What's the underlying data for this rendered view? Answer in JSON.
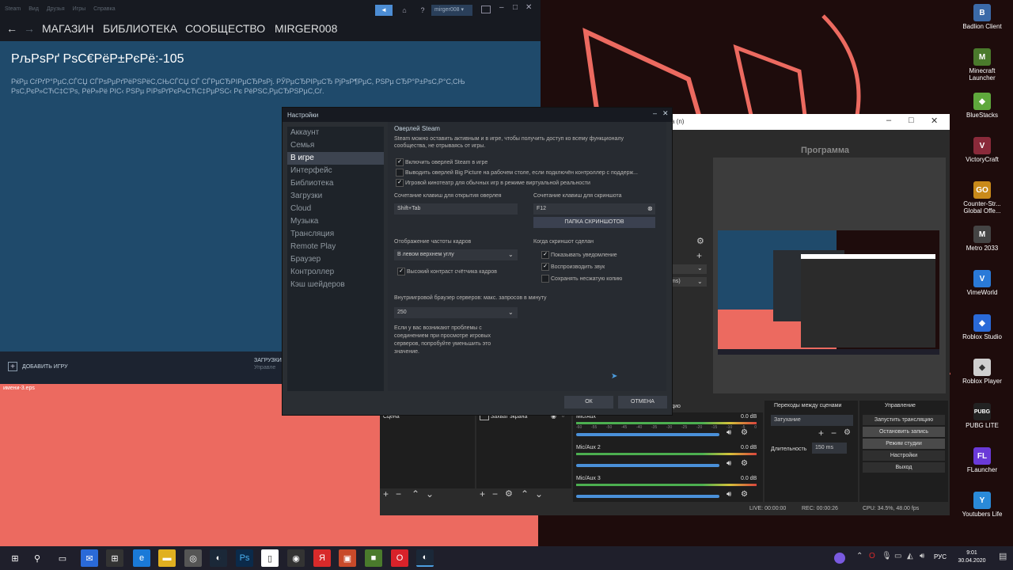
{
  "steam": {
    "titlebar_menu": [
      "Steam",
      "Вид",
      "Друзья",
      "Игры",
      "Справка"
    ],
    "username_pill": "mirger008",
    "help_label": "?",
    "nav": [
      "МАГАЗИН",
      "БИБЛИОТЕКА",
      "СООБЩЕСТВО",
      "MIRGER008"
    ],
    "page_title": "РљРѕРґ РѕС€РёР±РєРё:-105",
    "page_error_line1": "РќРµ СѓРґР°РµС‚СЃСЏ СЃРѕРµРґРёРЅРёС‚СЊСЃСЏ СЃ СЃРµСЂРІРµСЂРѕРј. РЎРµСЂРІРµСЂ РјРѕР¶РµС‚ РЅРµ СЂР°Р±РѕС‚Р°С‚СЊ",
    "page_error_line2": "РѕС‚РєР»СЋС‡С'Рѕ, РёР»Рё РІС‹ РЅРµ РїРѕРґРєР»СЋС‡РµРЅС‹ Рє РёРЅС‚РµСЂРЅРµС‚Сѓ.",
    "add_game": "ДОБАВИТЬ ИГРУ",
    "downloads": "ЗАГРУЗКИ",
    "downloads_sub": "Управле",
    "desktop_file": "имени-3.eps"
  },
  "settings": {
    "title": "Настройки",
    "sidebar": [
      "Аккаунт",
      "Семья",
      "В игре",
      "Интерфейс",
      "Библиотека",
      "Загрузки",
      "Cloud",
      "Музыка",
      "Трансляция",
      "Remote Play",
      "Браузер",
      "Контроллер",
      "Кэш шейдеров"
    ],
    "active_index": 2,
    "section_title": "Оверлей Steam",
    "section_desc_1": "Steam можно оставить активным и в игре, чтобы получить доступ ко всему функционалу",
    "section_desc_2": "сообщества, не отрываясь от игры.",
    "checkboxes": [
      {
        "label": "Включить оверлей Steam в игре",
        "checked": true
      },
      {
        "label": "Выводить оверлей Big Picture на рабочем столе, если подключён контроллер с поддерж...",
        "checked": false
      },
      {
        "label": "Игровой кинотеатр для обычных игр в режиме виртуальной реальности",
        "checked": true
      }
    ],
    "hotkey_overlay_label": "Сочетание клавиш для открытия оверлея",
    "hotkey_overlay_value": "Shift+Tab",
    "hotkey_screenshot_label": "Сочетание клавиш для скриншота",
    "hotkey_screenshot_value": "F12",
    "screenshot_folder_btn": "ПАПКА СКРИНШОТОВ",
    "fps_label": "Отображение частоты кадров",
    "fps_value": "В левом верхнем углу",
    "fps_contrast": {
      "label": "Высокий контраст счётчика кадров",
      "checked": true
    },
    "when_shot_label": "Когда скриншот сделан",
    "when_shot": [
      {
        "label": "Показывать уведомление",
        "checked": true
      },
      {
        "label": "Воспроизводить звук",
        "checked": true
      },
      {
        "label": "Сохранять несжатую копию",
        "checked": false
      }
    ],
    "browser_label": "Внутриигровой браузер серверов: макс. запросов в минуту",
    "browser_value": "250",
    "browser_hint": [
      "Если у вас возникают проблемы с",
      "соединением при просмотре игровых",
      "серверов, попробуйте уменьшить это",
      "значение."
    ],
    "ok_btn": "ОК",
    "cancel_btn": "ОТМЕНА"
  },
  "obs": {
    "title_fragment": "а (n)",
    "program_label": "Программа",
    "scenes_header": "Сцена",
    "sources_item": "Захват экрана",
    "mixer_header": "дио",
    "mixer": [
      {
        "name": "Mic/Aux",
        "db": "0.0 dB",
        "level": 0.78
      },
      {
        "name": "Mic/Aux 2",
        "db": "0.0 dB",
        "level": 0.78
      },
      {
        "name": "Mic/Aux 3",
        "db": "0.0 dB",
        "level": 0.78
      }
    ],
    "meter_ticks": [
      "-60",
      "-55",
      "-50",
      "-45",
      "-40",
      "-35",
      "-30",
      "-25",
      "-20",
      "-15",
      "-10",
      "-5",
      "0"
    ],
    "transitions_header": "Переходы между сценами",
    "transition_value": "Затухание",
    "duration_label": "Длительность",
    "duration_value": "150 ms",
    "controls_header": "Управление",
    "controls": [
      "Запустить трансляцию",
      "Остановить запись",
      "Режим студии",
      "Настройки",
      "Выход"
    ],
    "left_fragment": "ms)",
    "status_live": "LIVE: 00:00:00",
    "status_rec": "REC: 00:00:26",
    "status_cpu": "CPU: 34.5%, 48.00 fps"
  },
  "desktop_icons": [
    {
      "label": "Badlion Client",
      "color": "#3b6aa8",
      "glyph": "B"
    },
    {
      "label": "Minecraft Launcher",
      "color": "#4a7a2c",
      "glyph": "M"
    },
    {
      "label": "BlueStacks",
      "color": "#5fa83c",
      "glyph": "◆"
    },
    {
      "label": "VictoryCraft",
      "color": "#8a2a3a",
      "glyph": "V"
    },
    {
      "label": "Counter-Str... Global Offe...",
      "color": "#c98a1a",
      "glyph": "GO"
    },
    {
      "label": "Metro 2033",
      "color": "#444",
      "glyph": "M"
    },
    {
      "label": "VimeWorld",
      "color": "#2a7ad8",
      "glyph": "V"
    },
    {
      "label": "Roblox Studio",
      "color": "#2a6ad8",
      "glyph": "◆"
    },
    {
      "label": "Roblox Player",
      "color": "#cfcfcf",
      "glyph": "◆"
    },
    {
      "label": "PUBG LITE",
      "color": "#222",
      "glyph": "PUBG"
    },
    {
      "label": "FLauncher",
      "color": "#6a3ad8",
      "glyph": "FL"
    },
    {
      "label": "Youtubers Life",
      "color": "#2a8ad8",
      "glyph": "Y"
    }
  ],
  "taskbar": {
    "lang": "РУС",
    "time": "9:01",
    "date": "30.04.2020"
  }
}
